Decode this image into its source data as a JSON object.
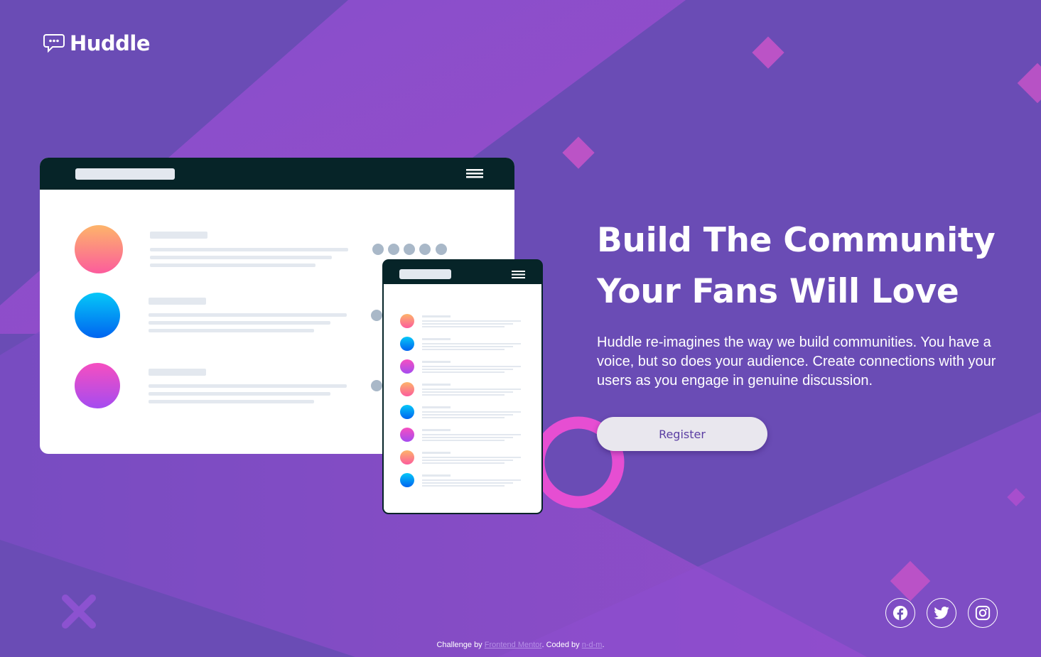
{
  "brand": {
    "name": "Huddle",
    "logo_icon": "chat-bubble-icon"
  },
  "hero": {
    "title_line1": "Build The Community",
    "title_line2": "Your Fans Will Love",
    "description": "Huddle re-imagines the way we build communities. You have a voice, but so does your audience. Create connections with your users as you engage in genuine discussion.",
    "register_label": "Register"
  },
  "social": [
    {
      "icon": "facebook-icon"
    },
    {
      "icon": "twitter-icon"
    },
    {
      "icon": "instagram-icon"
    }
  ],
  "attribution": {
    "prefix": "Challenge by",
    "link1": "Frontend Mentor",
    "middle": ". Coded by",
    "link2": "n-d-m",
    "suffix": "."
  },
  "colors": {
    "background": "#6a4cb5",
    "accent_pink": "#e54bd0",
    "button_text": "#5b3ea3",
    "mockup_header": "#062428"
  }
}
